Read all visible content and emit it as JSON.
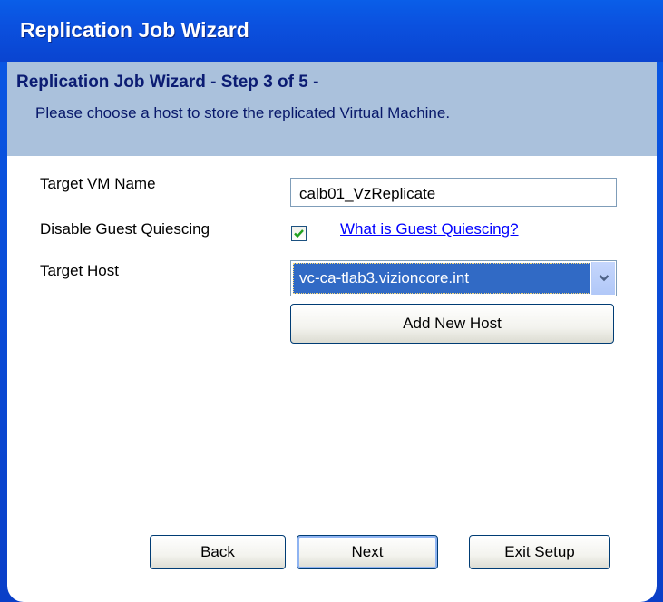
{
  "window": {
    "title": "Replication Job Wizard"
  },
  "header": {
    "step_title": "Replication Job Wizard  - Step 3 of 5 -",
    "description": "Please choose a host to store the replicated Virtual Machine."
  },
  "form": {
    "target_vm_name_label": "Target VM Name",
    "target_vm_name_value": "calb01_VzReplicate",
    "disable_quiescing_label": "Disable Guest Quiescing",
    "disable_quiescing_checked": true,
    "quiescing_help_link": "What is Guest Quiescing?",
    "target_host_label": "Target Host",
    "target_host_selected": "vc-ca-tlab3.vizioncore.int",
    "add_new_host_label": "Add New Host"
  },
  "buttons": {
    "back_label": "Back",
    "next_label": "Next",
    "exit_label": "Exit Setup"
  },
  "icons": {
    "checkbox_check": "checkmark-icon",
    "combo_arrow": "chevron-down-icon"
  },
  "colors": {
    "titlebar": "#0a5ee8",
    "header_band": "#aac1dc",
    "selection": "#316ac5",
    "link": "#0000ff",
    "check": "#21a121"
  }
}
